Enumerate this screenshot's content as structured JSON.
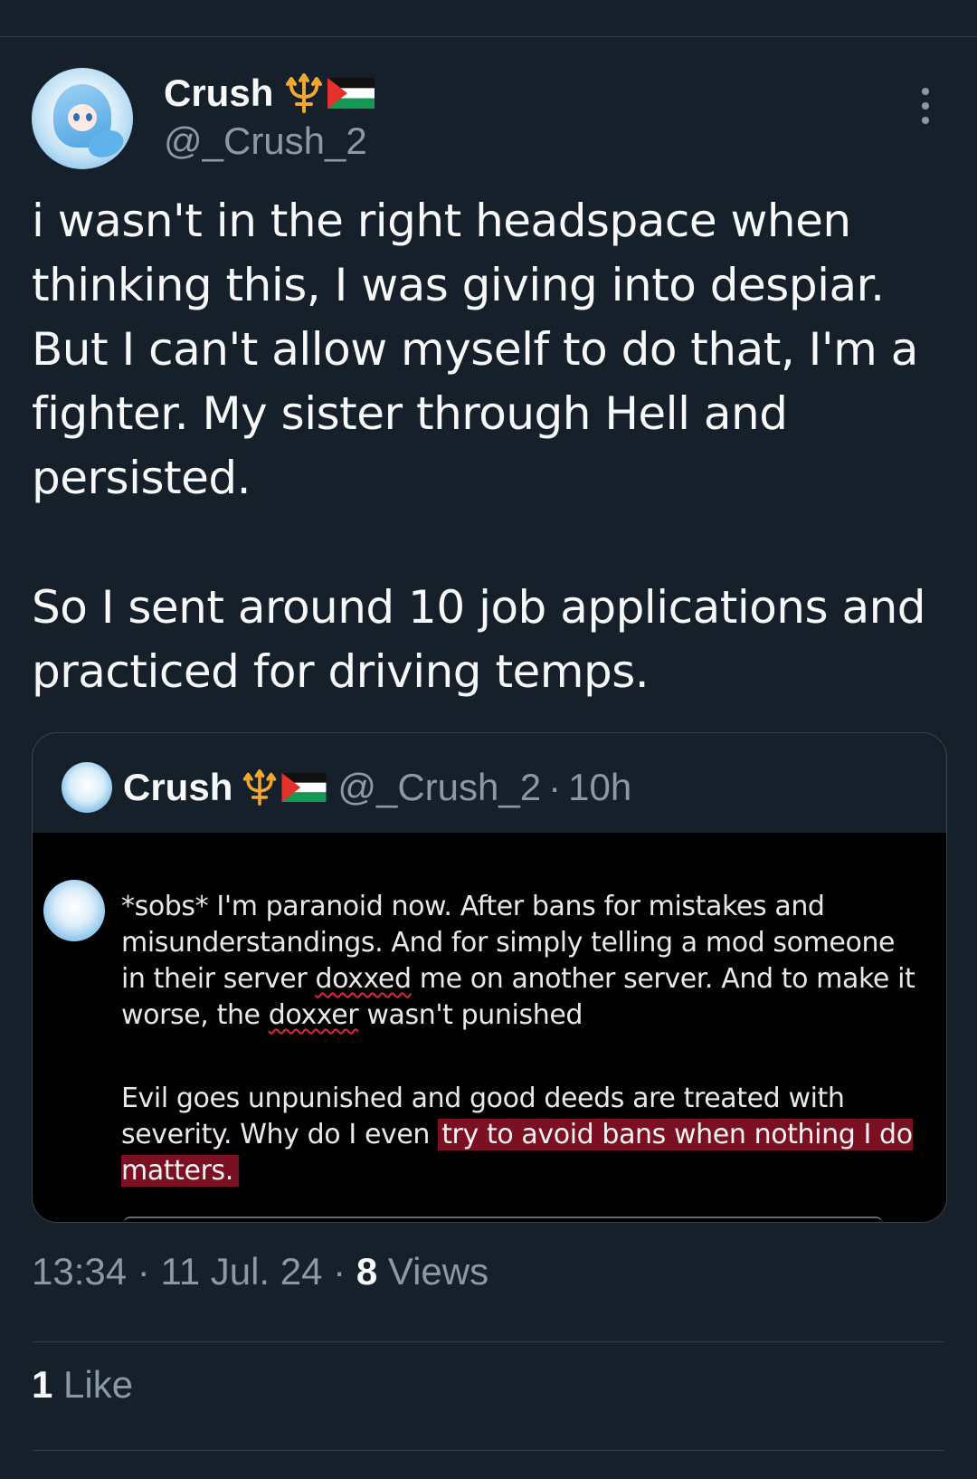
{
  "author": {
    "display_name": "Crush",
    "handle": "@_Crush_2",
    "badges": [
      "trident-icon",
      "palestine-flag-icon"
    ]
  },
  "tweet": {
    "paragraphs": [
      "i wasn't in the right headspace when thinking this, I was giving into despiar. But I can't allow myself to do that, I'm a fighter. My sister through Hell and persisted.",
      "So I sent around 10 job applications and practiced for driving temps."
    ],
    "time": "13:34",
    "date": "11 Jul. 24",
    "separator": "·",
    "views_count": "8",
    "views_label": "Views",
    "likes_count": "1",
    "likes_label": "Like"
  },
  "quoted": {
    "display_name": "Crush",
    "handle": "@_Crush_2",
    "separator": "·",
    "age": "10h",
    "screenshot": {
      "para1_a": "*sobs* I'm paranoid now. After bans for mistakes and misunderstandings. And for simply telling a mod someone in their server ",
      "para1_misspelled_1": "doxxed",
      "para1_b": " me on another server. And to make it worse, the ",
      "para1_misspelled_2": "doxxer",
      "para1_c": " wasn't punished",
      "para2_plain": "Evil goes unpunished and good deeds are treated with severity. Why do I even ",
      "para2_highlighted": "try to avoid bans when nothing I do matters."
    }
  },
  "colors": {
    "background": "#15202b",
    "text": "#f7f9f9",
    "secondary_text": "#8b98a5",
    "divider": "#2f3b47",
    "highlight": "#7a1022",
    "spellcheck": "#e0263c"
  }
}
